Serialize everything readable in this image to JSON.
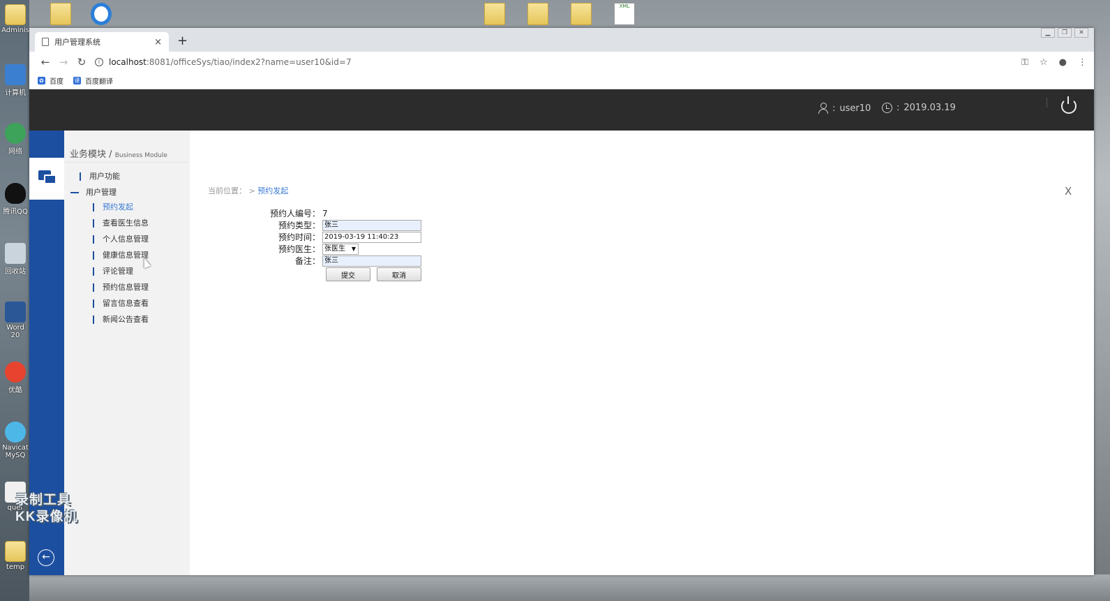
{
  "desktop": {
    "icons": [
      {
        "name": "admin-folder-icon",
        "label": "Adminis"
      },
      {
        "name": "computer-icon",
        "label": "计算机"
      },
      {
        "name": "network-icon",
        "label": "网络"
      },
      {
        "name": "qq-icon",
        "label": "腾讯QQ"
      },
      {
        "name": "recycle-bin-icon",
        "label": "回收站"
      },
      {
        "name": "word-icon",
        "label": "Word 20"
      },
      {
        "name": "youku-icon",
        "label": "优酷"
      },
      {
        "name": "navicat-icon",
        "label": "Navicat MySQ"
      },
      {
        "name": "jquery-icon",
        "label": "quer"
      },
      {
        "name": "temp-folder-icon",
        "label": "temp"
      }
    ],
    "xml_label": "XML",
    "watermark_line1": "录制工具",
    "watermark_line2": "KK录像机"
  },
  "browser": {
    "tab_title": "用户管理系统",
    "tab_close": "×",
    "new_tab": "+",
    "url_host": "localhost",
    "url_path": ":8081/officeSys/tiao/index2?name=user10&id=7",
    "bookmarks": [
      "百度",
      "百度翻译"
    ]
  },
  "header": {
    "user_sep": ":",
    "username": "user10",
    "date_sep": ":",
    "date": "2019.03.19"
  },
  "sidebar": {
    "title": "业务模块",
    "title_sep": "/",
    "title_en": "Business Module",
    "group1": "用户功能",
    "group2": "用户管理",
    "items": [
      "预约发起",
      "查看医生信息",
      "个人信息管理",
      "健康信息管理",
      "评论管理",
      "预约信息管理",
      "留言信息查看",
      "新闻公告查看"
    ]
  },
  "breadcrumb": {
    "label": "当前位置：",
    "sep": ">",
    "current": "预约发起"
  },
  "close": "X",
  "form": {
    "id_label": "预约人编号：",
    "id_value": "7",
    "type_label": "预约类型：",
    "type_value": "张三",
    "time_label": "预约时间：",
    "time_value": "2019-03-19 11:40:23",
    "doctor_label": "预约医生：",
    "doctor_value": "张医生",
    "note_label": "备注：",
    "note_value": "张三",
    "submit": "提交",
    "cancel": "取消"
  }
}
